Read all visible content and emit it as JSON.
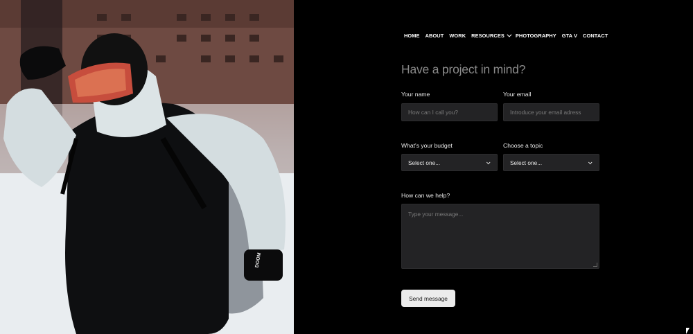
{
  "nav": {
    "items": [
      "HOME",
      "ABOUT",
      "WORK",
      "RESOURCES",
      "PHOTOGRAPHY",
      "GTA V",
      "CONTACT"
    ]
  },
  "form": {
    "title": "Have a project in mind?",
    "name_label": "Your name",
    "name_placeholder": "How can I call you?",
    "email_label": "Your email",
    "email_placeholder": "Introduce your email adress",
    "budget_label": "What's your budget",
    "budget_value": "Select one...",
    "topic_label": "Choose a topic",
    "topic_value": "Select one...",
    "message_label": "How can we help?",
    "message_placeholder": "Type your message...",
    "send_label": "Send message"
  },
  "photo": {
    "glove_text": "DOOM"
  },
  "colors": {
    "background": "#000000",
    "field_bg": "#232325",
    "button_bg": "#ececec",
    "title": "#8a8a8a"
  }
}
